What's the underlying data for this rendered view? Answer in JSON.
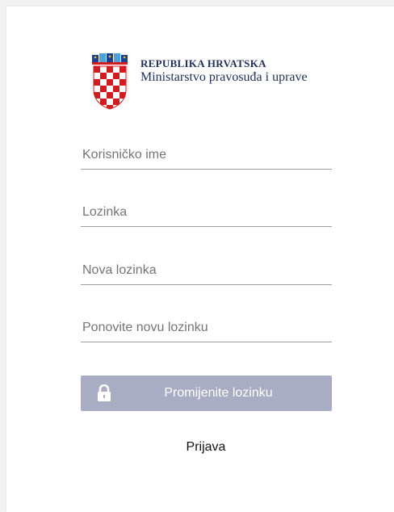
{
  "header": {
    "country": "REPUBLIKA HRVATSKA",
    "ministry": "Ministarstvo pravosuđa i uprave"
  },
  "form": {
    "username_placeholder": "Korisničko ime",
    "password_placeholder": "Lozinka",
    "new_password_placeholder": "Nova lozinka",
    "repeat_password_placeholder": "Ponovite novu lozinku",
    "submit_label": "Promijenite lozinku",
    "login_link": "Prijava"
  },
  "colors": {
    "button_bg": "#a9adc3",
    "title_text": "#1f2e5c"
  },
  "icons": {
    "logo": "coat-of-arms-icon",
    "submit": "lock-icon"
  }
}
